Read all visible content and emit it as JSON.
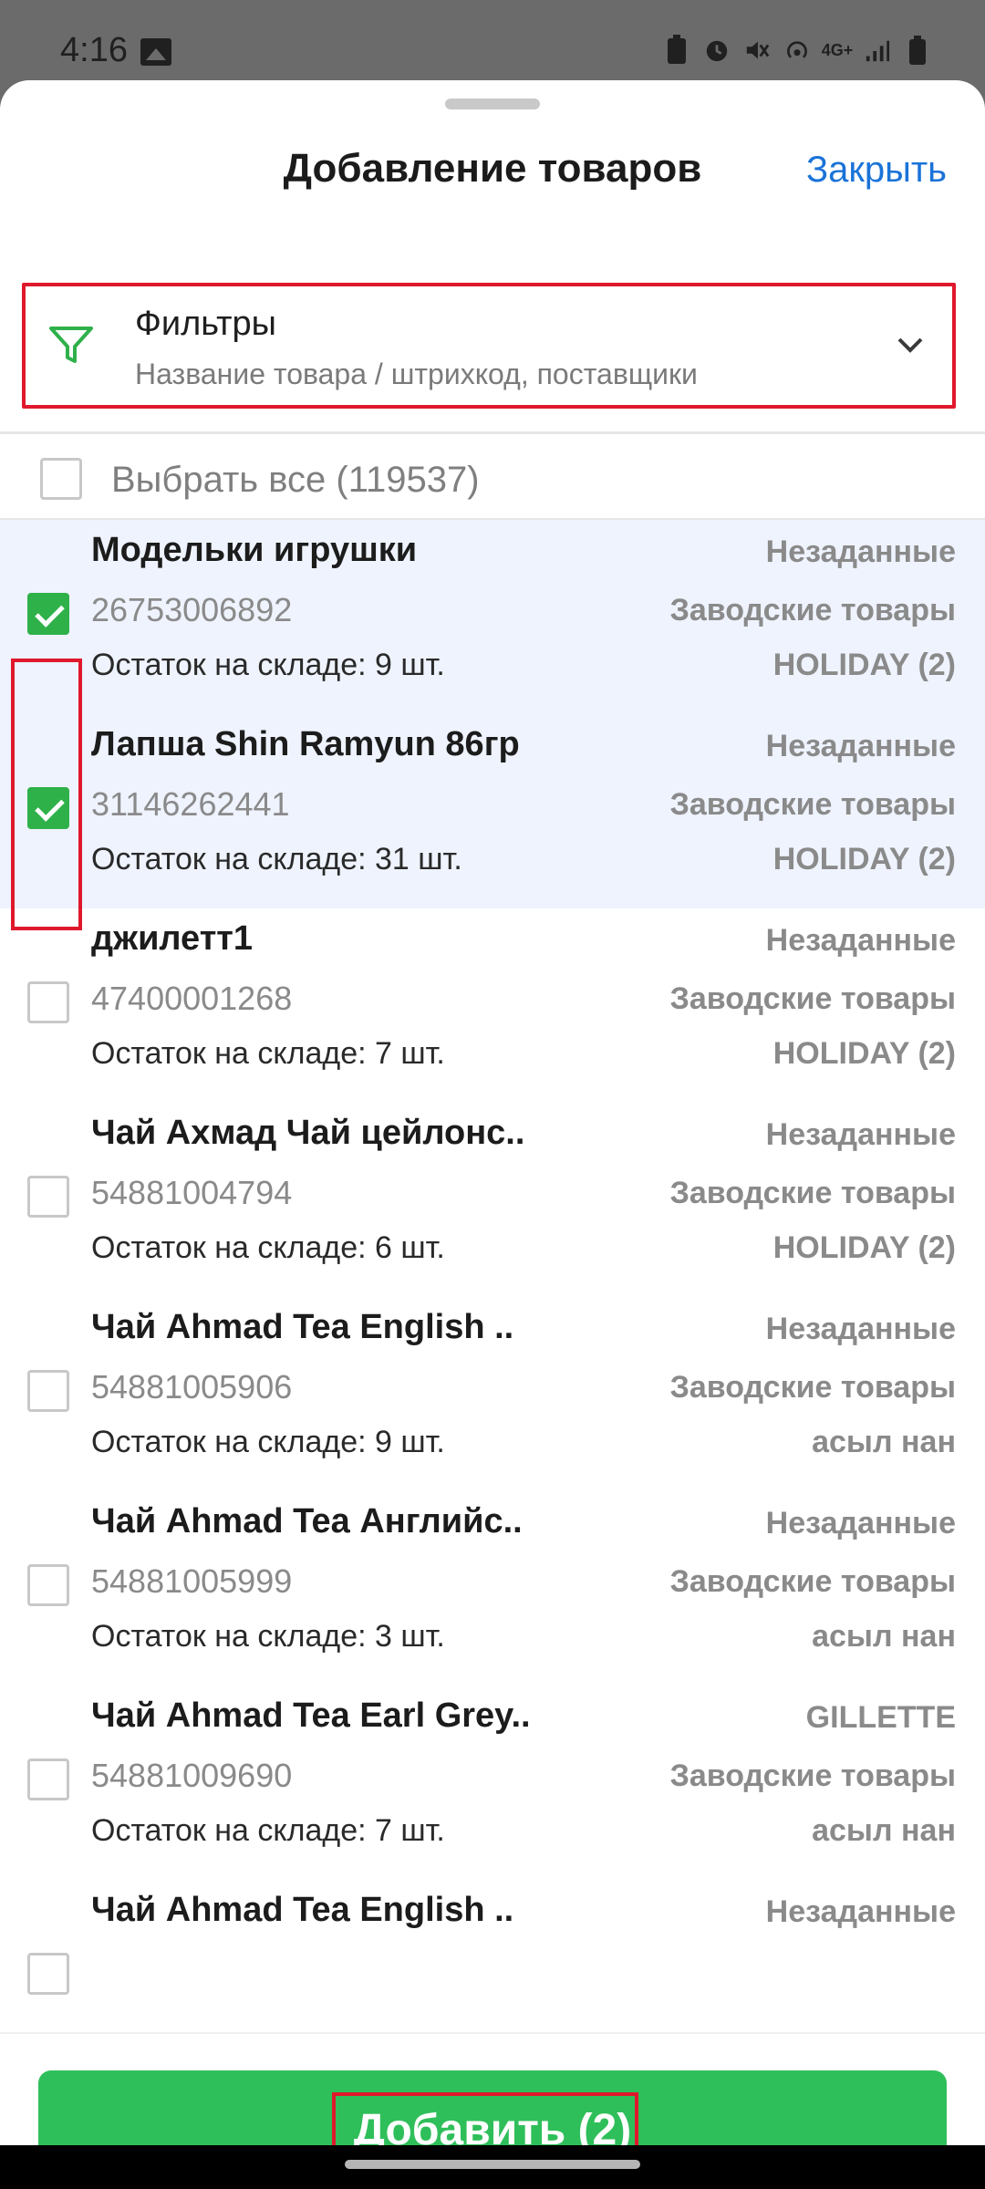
{
  "status_bar": {
    "time": "4:16",
    "network_label": "4G+",
    "icons": [
      "image-icon",
      "battery-saver-icon",
      "alarm-icon",
      "mute-icon",
      "hotspot-icon",
      "network-icon",
      "signal-icon",
      "battery-icon"
    ]
  },
  "sheet": {
    "title": "Добавление товаров",
    "close_label": "Закрыть"
  },
  "filter": {
    "title": "Фильтры",
    "subtitle": "Название товара / штрихкод, поставщики",
    "icon": "filter-icon"
  },
  "select_all": {
    "label": "Выбрать все (119537)",
    "checked": false
  },
  "items": [
    {
      "name": "Модельки игрушки",
      "code": "26753006892",
      "stock": "Остаток на складе: 9 шт.",
      "tag1": "Незаданные",
      "tag2": "Заводские товары",
      "tag3": "HOLIDAY (2)",
      "checked": true
    },
    {
      "name": "Лапша Shin Ramyun 86гр",
      "code": "31146262441",
      "stock": "Остаток на складе: 31 шт.",
      "tag1": "Незаданные",
      "tag2": "Заводские товары",
      "tag3": "HOLIDAY (2)",
      "checked": true
    },
    {
      "name": "джилетт1",
      "code": "47400001268",
      "stock": "Остаток на складе: 7 шт.",
      "tag1": "Незаданные",
      "tag2": "Заводские товары",
      "tag3": "HOLIDAY (2)",
      "checked": false
    },
    {
      "name": "Чай Ахмад Чай цейлонс..",
      "code": "54881004794",
      "stock": "Остаток на складе: 6 шт.",
      "tag1": "Незаданные",
      "tag2": "Заводские товары",
      "tag3": "HOLIDAY (2)",
      "checked": false
    },
    {
      "name": "Чай Ahmad Tea English ..",
      "code": "54881005906",
      "stock": "Остаток на складе: 9 шт.",
      "tag1": "Незаданные",
      "tag2": "Заводские товары",
      "tag3": "асыл нан",
      "checked": false
    },
    {
      "name": "Чай Ahmad Tea Английс..",
      "code": "54881005999",
      "stock": "Остаток на складе: 3 шт.",
      "tag1": "Незаданные",
      "tag2": "Заводские товары",
      "tag3": "асыл нан",
      "checked": false
    },
    {
      "name": "Чай Ahmad Tea Earl Grey..",
      "code": "54881009690",
      "stock": "Остаток на складе: 7 шт.",
      "tag1": "GILLETTE",
      "tag2": "Заводские товары",
      "tag3": "асыл нан",
      "checked": false
    },
    {
      "name": "Чай Ahmad Tea English ..",
      "code": "",
      "stock": "",
      "tag1": "Незаданные",
      "tag2": "",
      "tag3": "",
      "checked": false
    }
  ],
  "add_button": {
    "label": "Добавить (2)"
  },
  "colors": {
    "accent_green": "#2fbf5a",
    "link_blue": "#1a73d8",
    "highlight_red": "#e0182c",
    "selected_row_bg": "#eef3fe"
  }
}
